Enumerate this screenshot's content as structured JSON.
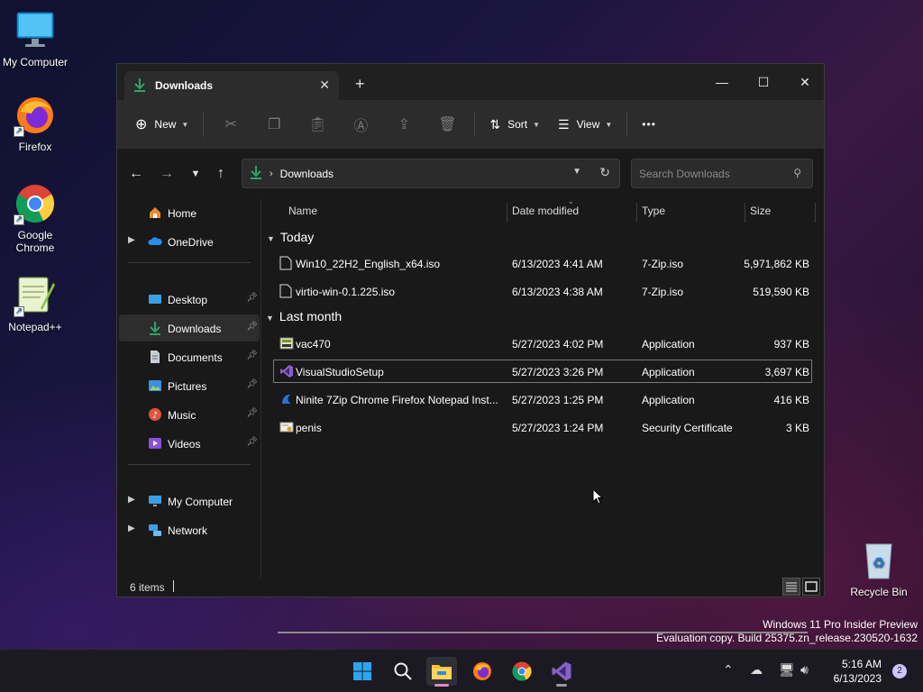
{
  "desktop": {
    "icons": [
      {
        "label": "My Computer"
      },
      {
        "label": "Firefox"
      },
      {
        "label": "Google Chrome"
      },
      {
        "label": "Notepad++"
      },
      {
        "label": "Recycle Bin"
      }
    ]
  },
  "window": {
    "tab_title": "Downloads",
    "tab_close": "✕",
    "new_tab": "+",
    "minimize": "—",
    "maximize": "☐",
    "close": "✕"
  },
  "toolbar": {
    "new_label": "New",
    "sort_label": "Sort",
    "view_label": "View",
    "more_label": "•••"
  },
  "address": {
    "path": "Downloads",
    "search_placeholder": "Search Downloads"
  },
  "sidebar": {
    "items": [
      {
        "label": "Home"
      },
      {
        "label": "OneDrive"
      },
      {
        "label": "Desktop"
      },
      {
        "label": "Downloads"
      },
      {
        "label": "Documents"
      },
      {
        "label": "Pictures"
      },
      {
        "label": "Music"
      },
      {
        "label": "Videos"
      },
      {
        "label": "My Computer"
      },
      {
        "label": "Network"
      }
    ]
  },
  "columns": {
    "name": "Name",
    "date": "Date modified",
    "type": "Type",
    "size": "Size"
  },
  "groups": [
    {
      "label": "Today",
      "files": [
        {
          "name": "Win10_22H2_English_x64.iso",
          "date": "6/13/2023 4:41 AM",
          "type": "7-Zip.iso",
          "size": "5,971,862 KB"
        },
        {
          "name": "virtio-win-0.1.225.iso",
          "date": "6/13/2023 4:38 AM",
          "type": "7-Zip.iso",
          "size": "519,590 KB"
        }
      ]
    },
    {
      "label": "Last month",
      "files": [
        {
          "name": "vac470",
          "date": "5/27/2023 4:02 PM",
          "type": "Application",
          "size": "937 KB"
        },
        {
          "name": "VisualStudioSetup",
          "date": "5/27/2023 3:26 PM",
          "type": "Application",
          "size": "3,697 KB"
        },
        {
          "name": "Ninite 7Zip Chrome Firefox Notepad Inst...",
          "date": "5/27/2023 1:25 PM",
          "type": "Application",
          "size": "416 KB"
        },
        {
          "name": "penis",
          "date": "5/27/2023 1:24 PM",
          "type": "Security Certificate",
          "size": "3 KB"
        }
      ]
    }
  ],
  "status": {
    "count": "6 items"
  },
  "watermark": {
    "line1": "Windows 11 Pro Insider Preview",
    "line2": "Evaluation copy. Build 25375.zn_release.230520-1632"
  },
  "taskbar": {
    "time": "5:16 AM",
    "date": "6/13/2023",
    "notifications": "2"
  },
  "colors": {
    "accent": "#2ea36b",
    "folder": "#f4c23c"
  }
}
